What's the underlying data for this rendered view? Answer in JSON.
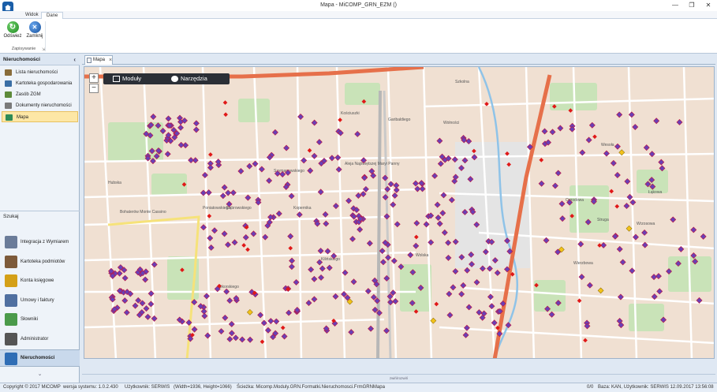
{
  "window": {
    "title": "Mapa - MiCOMP_GRN_EZM ()"
  },
  "ribbon": {
    "tabs": [
      {
        "label": "Widok"
      },
      {
        "label": "Dane"
      }
    ],
    "buttons": [
      {
        "label": "Odśwież",
        "icon": "refresh-icon"
      },
      {
        "label": "Zamknij",
        "icon": "close-icon"
      }
    ],
    "group_label": "Zapisywanie"
  },
  "sidebar": {
    "header": "Nieruchomości",
    "items": [
      {
        "label": "Lista nieruchomości",
        "icon": "list-icon",
        "color": "#8a6d3b"
      },
      {
        "label": "Kartoteka gospodarowania",
        "icon": "folder-icon",
        "color": "#3a6ea5"
      },
      {
        "label": "Zasób ZGM",
        "icon": "database-icon",
        "color": "#5d8a3a"
      },
      {
        "label": "Dokumenty nieruchomości",
        "icon": "document-icon",
        "color": "#7a7a7a"
      },
      {
        "label": "Mapa",
        "icon": "map-icon",
        "color": "#2e8b57"
      }
    ],
    "search_label": "Szukaj",
    "modules": [
      {
        "label": "Integracja z Wymiarem",
        "icon": "integration-icon",
        "color": "#6b7c99"
      },
      {
        "label": "Kartoteka podmiotów",
        "icon": "people-icon",
        "color": "#7d5a3a"
      },
      {
        "label": "Konta księgowe",
        "icon": "accounts-icon",
        "color": "#d4a017"
      },
      {
        "label": "Umowy i faktury",
        "icon": "contracts-icon",
        "color": "#4f6fa0"
      },
      {
        "label": "Słowniki",
        "icon": "dictionary-icon",
        "color": "#4a9a4a"
      },
      {
        "label": "Administrator",
        "icon": "admin-icon",
        "color": "#555555"
      }
    ],
    "active_module": {
      "label": "Nieruchomości",
      "icon": "house-icon",
      "color": "#2f6db5"
    }
  },
  "document_tab": {
    "label": "Mapa"
  },
  "map": {
    "toolbar": [
      {
        "label": "Moduły",
        "icon": "grid-icon"
      },
      {
        "label": "Narzędzia",
        "icon": "globe-icon"
      }
    ],
    "zoom_in": "+",
    "zoom_out": "−",
    "streets": [
      "Aleja Najświętszej Maryi Panny",
      "Szymanowskiego",
      "Kościuszki",
      "Garibaldiego",
      "Wolności",
      "Poniatowskiego",
      "Dąbrowskiego",
      "Kopernika",
      "Kilińskiego",
      "Wolska",
      "Hubska",
      "Szkolna",
      "Ogrodowa",
      "Wierzbowa",
      "Struga",
      "Wrzosowa",
      "Wesoła",
      "Łąkowa",
      "Sikorskiego",
      "Bohaterów Monte Cassino"
    ],
    "marker_colors": {
      "property": "#6a3fb5",
      "property_border": "#c0143c",
      "alert": "#e01818",
      "special": "#f2c21a"
    },
    "splitter_label": "zwiń/rozwiń"
  },
  "statusbar": {
    "copyright": "Copyright © 2017 MiCOMP",
    "version": "wersja systemu: 1.0.2.430",
    "user": "Użytkownik: SERWIS",
    "size": "(Width=1936, Height=1066)",
    "path": "Ścieżka: Micomp.Moduly.GRN.Formatki.Nieruchomosci.FrmGRNMapa",
    "count": "0/0",
    "base": "Baza: KAN, Użytkownik: SERWIS 12.09.2017 13:56:08"
  }
}
